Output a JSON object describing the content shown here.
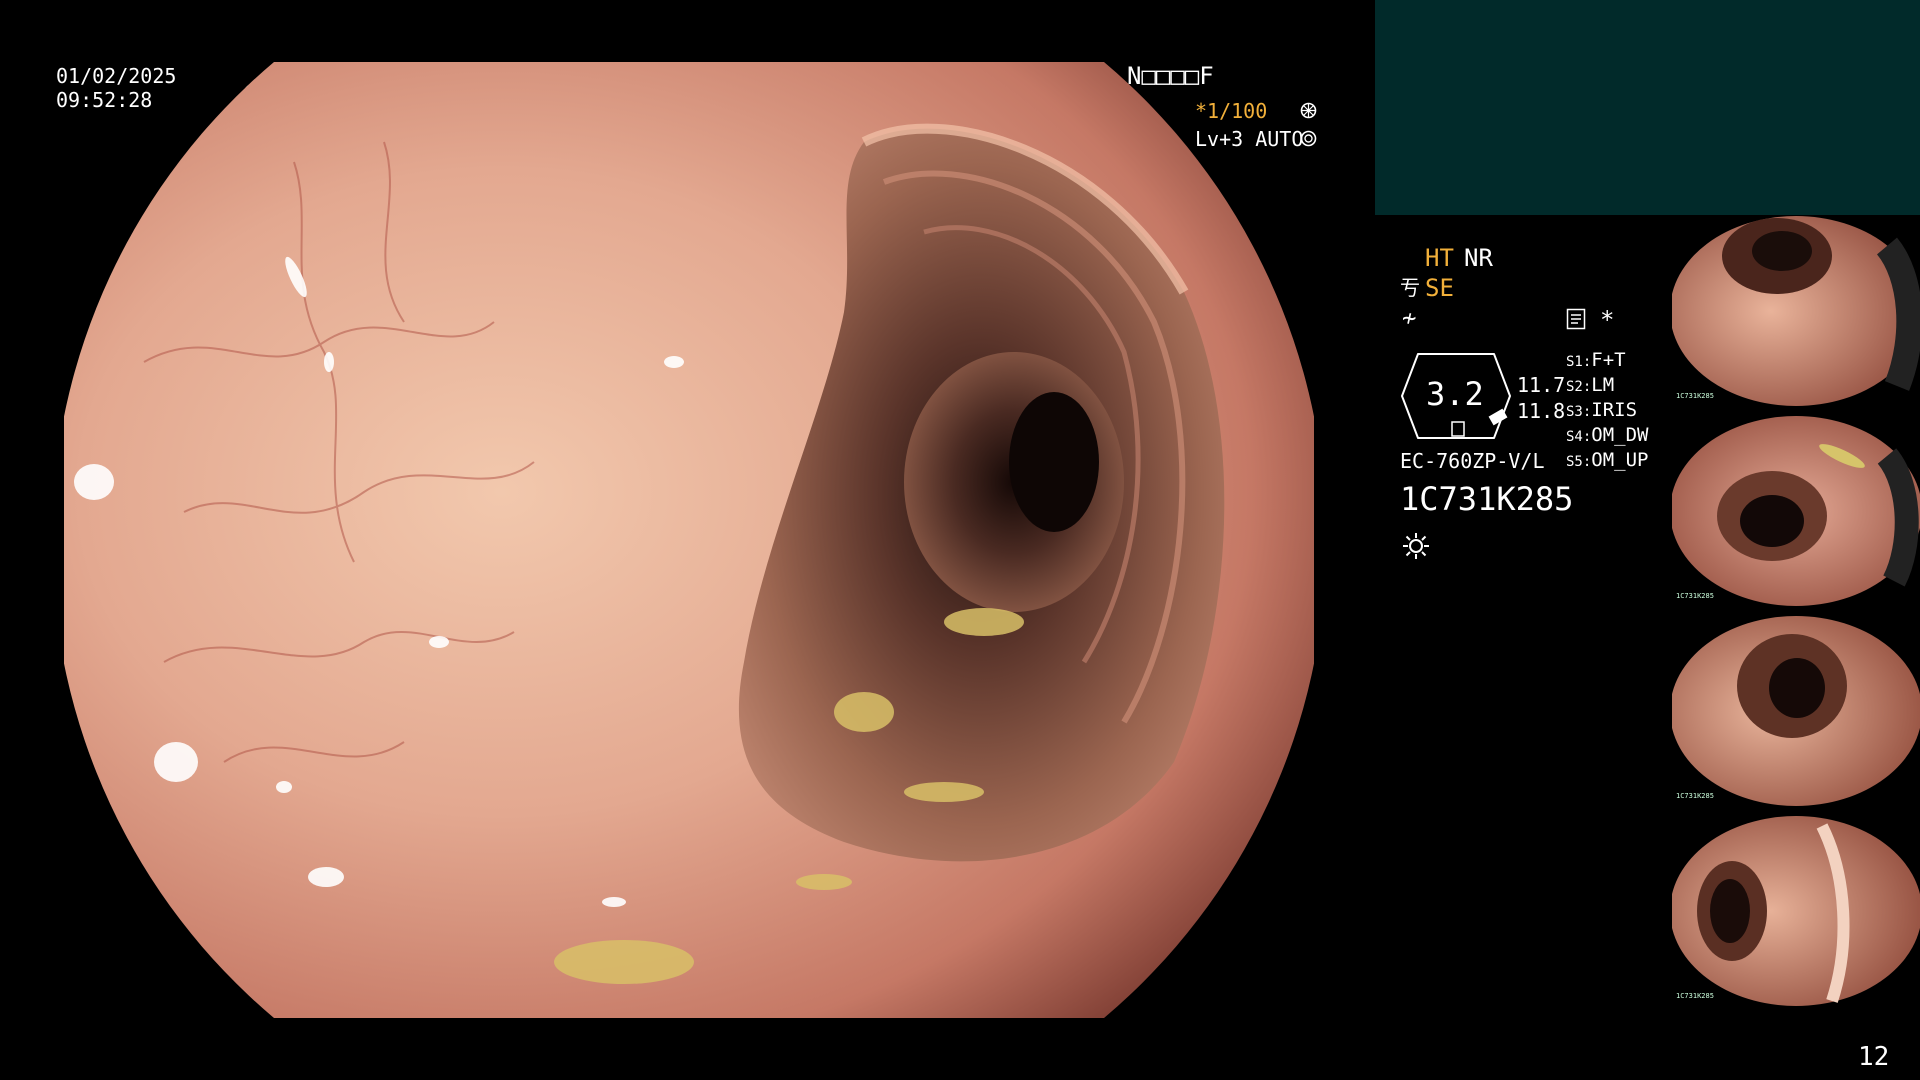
{
  "overlay": {
    "date": "01/02/2025",
    "time": "09:52:28",
    "mode_code": "N□□□□F",
    "shutter": "*1/100",
    "shutter_icon": "aperture-icon",
    "level": "Lv+3 AUTO",
    "level_icon": "iris-icon"
  },
  "settings": {
    "ht": "HT",
    "nr": "NR",
    "se_prefix": "亐",
    "se": "SE",
    "freeze_symbol": "≁",
    "record_icon": "memo-icon",
    "asterisk": "*",
    "zoom_value": "3.2",
    "value_top": "11.7",
    "value_bottom": "11.8",
    "scope_model": "EC-760ZP-V/L",
    "serial": "1C731K285",
    "light_icon": "sun-icon"
  },
  "switches": [
    {
      "key": "S1:",
      "value": "F+T"
    },
    {
      "key": "S2:",
      "value": "LM"
    },
    {
      "key": "S3:",
      "value": "IRIS"
    },
    {
      "key": "S4:",
      "value": "OM_DW"
    },
    {
      "key": "S5:",
      "value": "OM_UP"
    }
  ],
  "thumbnails": [
    {
      "name": "capture-1"
    },
    {
      "name": "capture-2"
    },
    {
      "name": "capture-3"
    },
    {
      "name": "capture-4"
    }
  ],
  "thumb_tag": "1C731K285",
  "page_number": "12",
  "colors": {
    "accent_orange": "#f2b03a",
    "panel_teal": "#012a2a",
    "mucosa": "#d9907a"
  }
}
